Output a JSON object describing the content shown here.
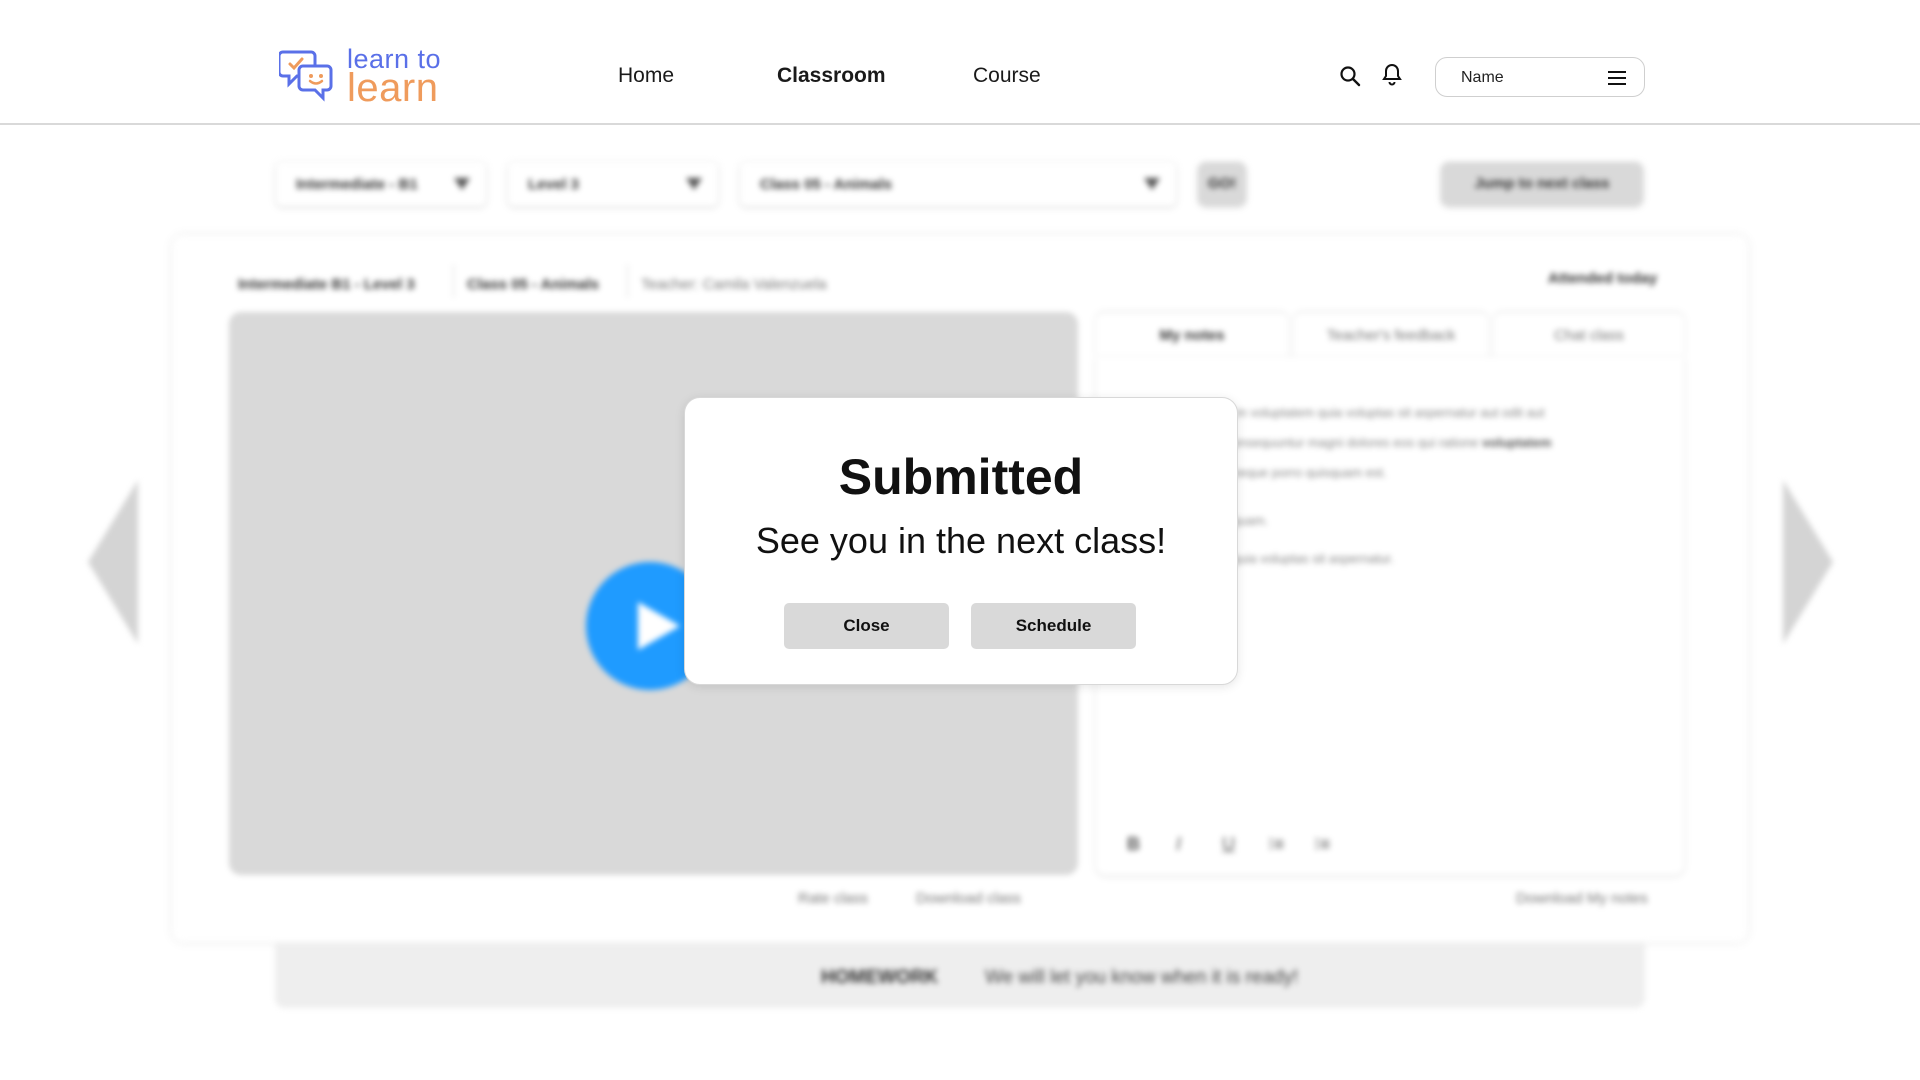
{
  "logo": {
    "line1": "learn to",
    "line2": "learn"
  },
  "nav": {
    "items": [
      "Home",
      "Classroom",
      "Course"
    ],
    "active": "Classroom"
  },
  "header": {
    "name_label": "Name"
  },
  "filters": {
    "level_group": "Intermediate - B1",
    "level": "Level 3",
    "class": "Class 05 - Animals",
    "go_label": "GO!",
    "jump_label": "Jump to next class"
  },
  "class_info": {
    "course": "Intermediate B1 - Level 3",
    "class": "Class 05 - Animals",
    "teacher": "Teacher: Camila Valenzuela",
    "attendance": "Attended today"
  },
  "tabs": [
    "My notes",
    "Teacher's feedback",
    "Chat class"
  ],
  "notes": {
    "line1": "m voluptatem quia voluptas sit aspernatur aut odit aut",
    "line2a": "onsequuntur magni dolores eos qui ratione ",
    "line2b": "voluptatem",
    "line3": "neque porro quisquam est.",
    "line4": "quam.",
    "line5": "quia voluptas sit aspernatur.",
    "toolbar": [
      "B",
      "I",
      "U",
      "⁝≡",
      "⁝≡"
    ]
  },
  "links": {
    "rate": "Rate class",
    "download": "Download class",
    "download_notes": "Download My notes"
  },
  "homework": {
    "title": "HOMEWORK",
    "text": "We will let you know when it is ready!"
  },
  "modal": {
    "title": "Submitted",
    "subtitle": "See you in the next class!",
    "close_label": "Close",
    "schedule_label": "Schedule"
  },
  "colors": {
    "logo_blue": "#5a70e8",
    "logo_orange": "#ef9b5c",
    "play_blue": "#1f9bff",
    "button_gray": "#d9d9d9"
  }
}
